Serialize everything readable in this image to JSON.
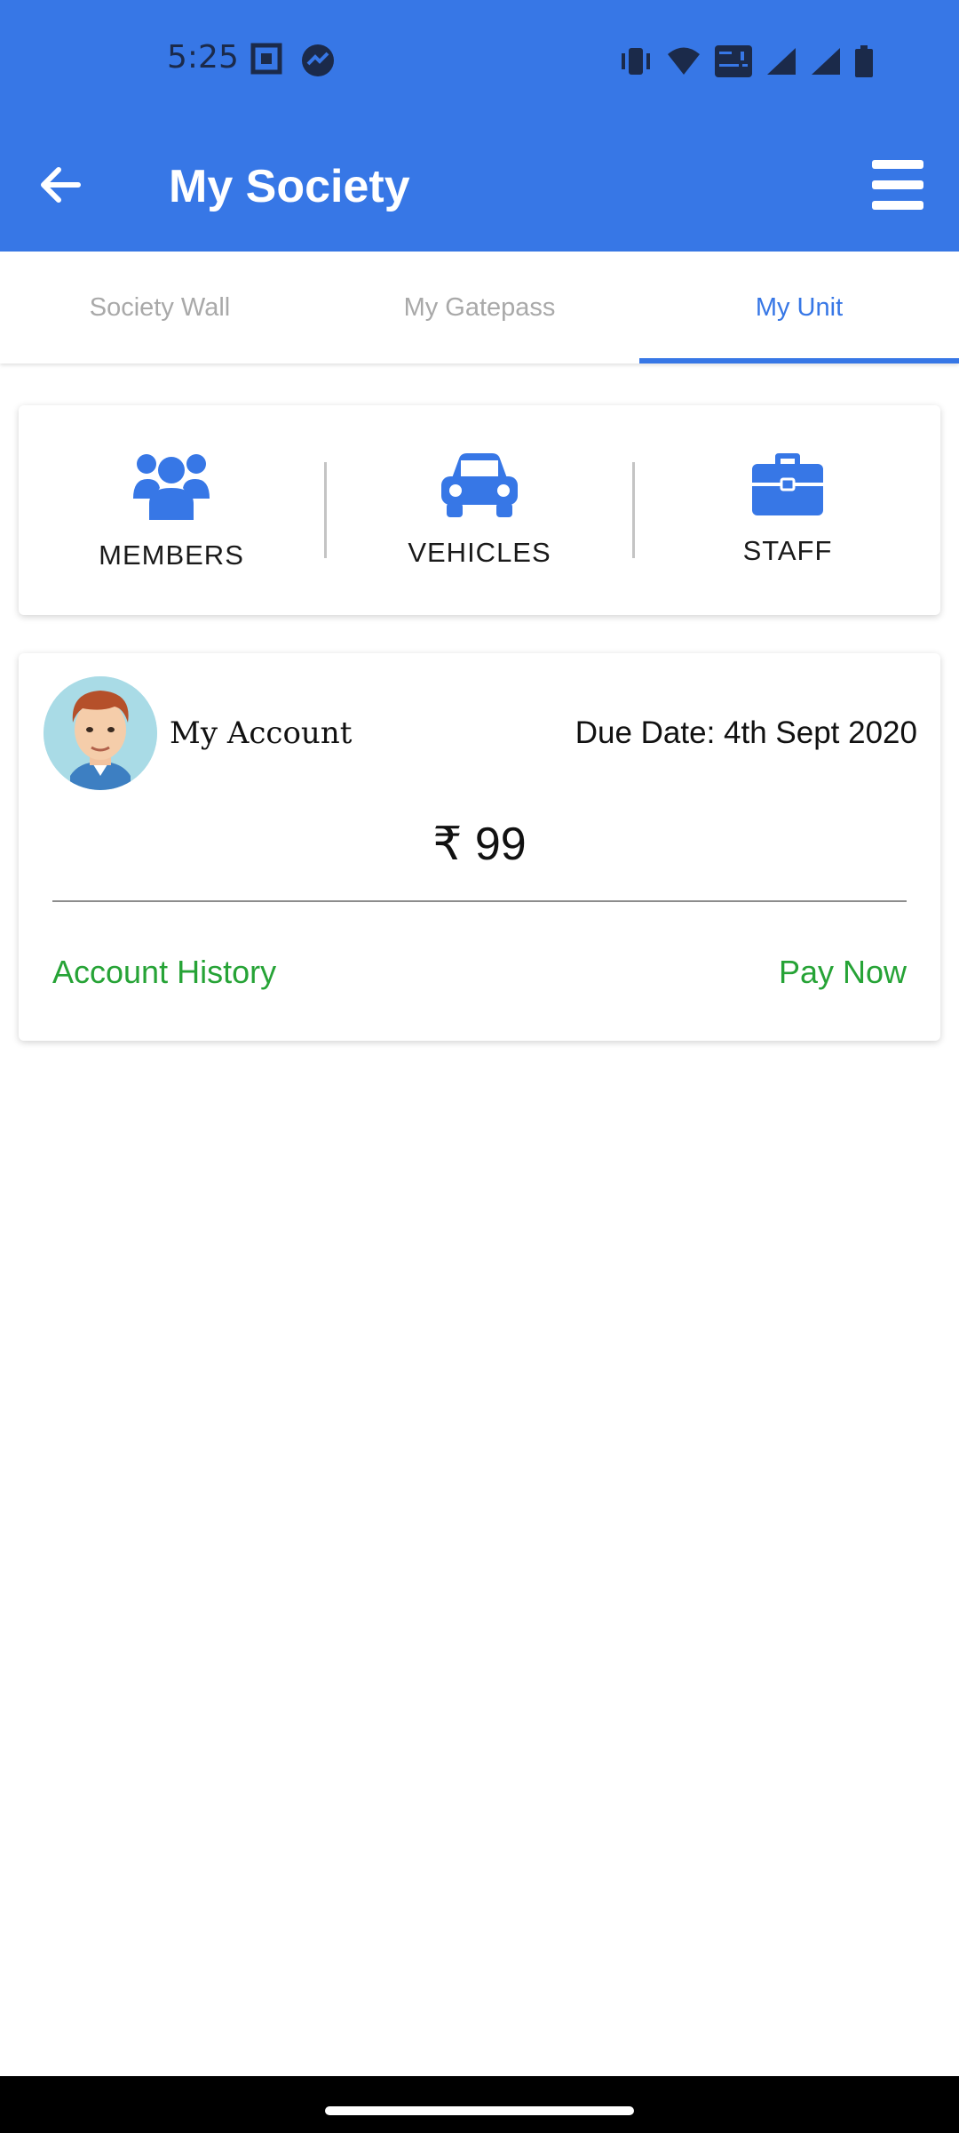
{
  "status_bar": {
    "time": "5:25"
  },
  "app_bar": {
    "title": "My Society"
  },
  "tabs": [
    {
      "label": "Society Wall",
      "active": false
    },
    {
      "label": "My Gatepass",
      "active": false
    },
    {
      "label": "My Unit",
      "active": true
    }
  ],
  "categories": [
    {
      "label": "MEMBERS",
      "icon": "users-icon"
    },
    {
      "label": "VEHICLES",
      "icon": "car-icon"
    },
    {
      "label": "STAFF",
      "icon": "briefcase-icon"
    }
  ],
  "account": {
    "label": "My Account",
    "due_date": "Due Date: 4th Sept 2020",
    "amount": "₹ 99",
    "history_link": "Account History",
    "pay_link": "Pay Now"
  },
  "colors": {
    "primary": "#3777e6",
    "accent_green": "#26a336",
    "tab_inactive": "#a9a9a9"
  }
}
